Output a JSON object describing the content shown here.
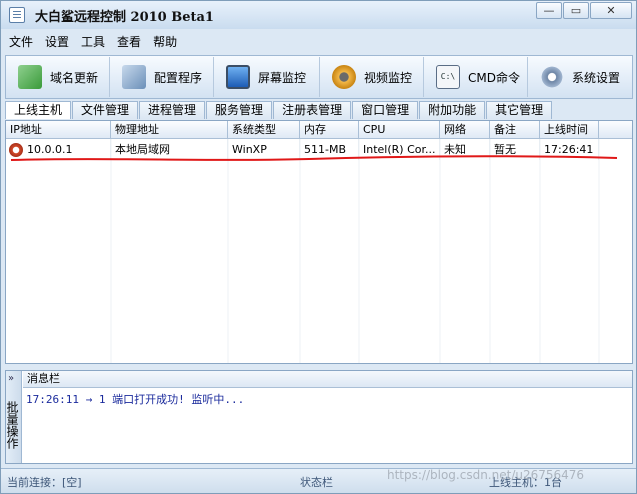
{
  "window": {
    "title": "大白鲨远程控制 2010 Beta1",
    "controls": [
      "—",
      "▭",
      "✕"
    ]
  },
  "menu": [
    "文件",
    "设置",
    "工具",
    "查看",
    "帮助"
  ],
  "toolbar": [
    {
      "label": "域名更新",
      "icon": "domain-update-icon",
      "color": "#4aa84a"
    },
    {
      "label": "配置程序",
      "icon": "config-icon",
      "color": "#6a8fb8"
    },
    {
      "label": "屏幕监控",
      "icon": "monitor-icon",
      "color": "#2f72c9"
    },
    {
      "label": "视频监控",
      "icon": "webcam-icon",
      "color": "#e8a62a"
    },
    {
      "label": "CMD命令",
      "icon": "cmd-icon",
      "color": "#5a6d86"
    },
    {
      "label": "系统设置",
      "icon": "settings-icon",
      "color": "#6e86a6"
    }
  ],
  "tabs": [
    "上线主机",
    "文件管理",
    "进程管理",
    "服务管理",
    "注册表管理",
    "窗口管理",
    "附加功能",
    "其它管理"
  ],
  "table": {
    "columns": [
      "IP地址",
      "物理地址",
      "系统类型",
      "内存",
      "CPU",
      "网络",
      "备注",
      "上线时间"
    ],
    "rows": [
      [
        "10.0.0.1",
        "本地局域网",
        "WinXP",
        "511-MB",
        "Intel(R) Cor...",
        "未知",
        "暂无",
        "17:26:41"
      ]
    ]
  },
  "messages": {
    "header": "消息栏",
    "sidebar_label": "批量操作",
    "lines": [
      "17:26:11 → 1 端口打开成功! 监听中..."
    ]
  },
  "status": {
    "connection": "当前连接：[空]",
    "center": "状态栏",
    "online": "上线主机：1台"
  },
  "watermark": "https://blog.csdn.net/u26756476"
}
